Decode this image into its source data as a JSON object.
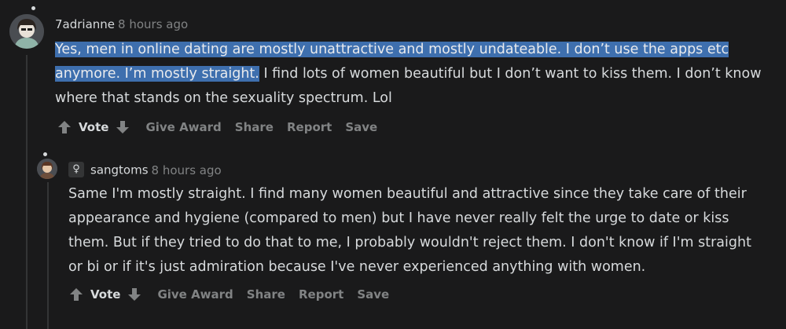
{
  "comment1": {
    "author": "7adrianne",
    "time": "8 hours ago",
    "body_highlighted": "Yes, men in online dating are mostly unattractive and mostly undateable. I don’t use the apps etc anymore. I’m mostly straight.",
    "body_rest": " I find lots of women beautiful but I don’t want to kiss them. I don’t know where that stands on the sexuality spectrum. Lol",
    "actions": {
      "vote_label": "Vote",
      "give_award": "Give Award",
      "share": "Share",
      "report": "Report",
      "save": "Save"
    }
  },
  "comment2": {
    "flair_icon": "♀",
    "author": "sangtoms",
    "time": "8 hours ago",
    "body": "Same I'm mostly straight. I find many women beautiful and attractive since they take care of their appearance and hygiene (compared to men) but I have never really felt the urge to date or kiss them. But if they tried to do that to me, I probably wouldn't reject them. I don't know if I'm straight or bi or if it's just admiration because I've never experienced anything with women.",
    "actions": {
      "vote_label": "Vote",
      "give_award": "Give Award",
      "share": "Share",
      "report": "Report",
      "save": "Save"
    }
  },
  "colors": {
    "background": "#1a1a1b",
    "text": "#d7dadc",
    "muted": "#818384",
    "highlight": "#3e6fae"
  }
}
